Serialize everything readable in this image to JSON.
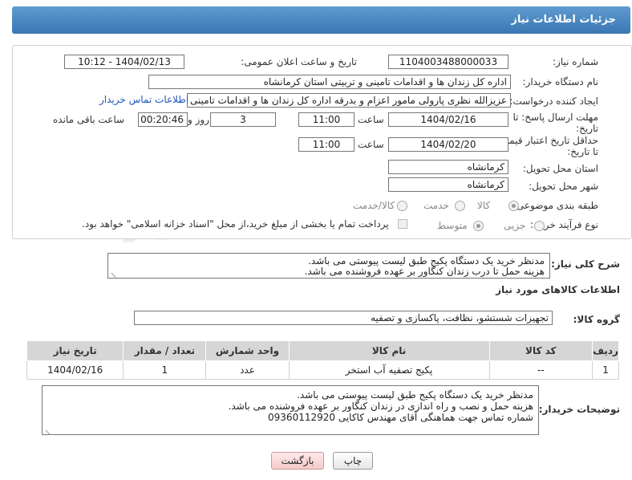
{
  "header": {
    "title": "جزئیات اطلاعات نیاز"
  },
  "form": {
    "need_number_label": "شماره نیاز:",
    "need_number": "1104003488000033",
    "announce_label": "تاریخ و ساعت اعلان عمومی:",
    "announce_value": "1404/02/13 - 10:12",
    "buyer_org_label": "نام دستگاه خریدار:",
    "buyer_org": "اداره کل زندان ها و اقدامات تامینی و تربیتی استان کرمانشاه",
    "creator_label": "ایجاد کننده درخواست:",
    "creator": "عزیزالله نظری پارولی مامور اعزام و بدرقه اداره کل زندان ها و اقدامات تامینی و تربیتی",
    "contact_link": "اطلاعات تماس خریدار",
    "deadline_label_line1": "مهلت ارسال پاسخ: تا",
    "deadline_label_line2": "تاریخ:",
    "deadline_date": "1404/02/16",
    "time_label": "ساعت",
    "deadline_time": "11:00",
    "days_value": "3",
    "days_label": "روز و",
    "remaining_time": "00:20:46",
    "remaining_label": "ساعت باقی مانده",
    "min_price_label_line1": "حداقل تاریخ اعتبار قیمت:",
    "min_price_label_line2": "تا تاریخ:",
    "min_price_date": "1404/02/20",
    "min_price_time": "11:00",
    "province_label": "استان محل تحویل:",
    "province": "کرمانشاه",
    "city_label": "شهر محل تحویل:",
    "city": "کرمانشاه",
    "category_label": "طبقه بندی موضوعی:",
    "category_options": [
      "کالا",
      "خدمت",
      "کالا/خدمت"
    ],
    "process_label": "نوع فرآیند خرید :",
    "process_options": [
      "جزیی",
      "متوسط"
    ],
    "payment_note": "پرداخت تمام یا بخشی از مبلغ خرید،از محل \"اسناد خزانه اسلامی\" خواهد بود."
  },
  "watermark": "AriaTender.net",
  "description": {
    "label": "شرح کلی نیاز:",
    "text": "مدنظر خرید یک دستگاه پکیج طبق لیست پیوستی می باشد.\nهزینه حمل تا درب زندان کنگاور بر عهده فروشنده می باشد."
  },
  "goods": {
    "section_title": "اطلاعات کالاهای مورد نیاز",
    "group_label": "گروه کالا:",
    "group_value": "تجهیزات شستشو، نظافت، پاکسازی و تصفیه",
    "columns": [
      "ردیف",
      "کد کالا",
      "نام کالا",
      "واحد شمارش",
      "تعداد / مقدار",
      "تاریخ نیاز"
    ],
    "rows": [
      {
        "index": "1",
        "code": "--",
        "name": "پکیج تصفیه آب استخر",
        "unit": "عدد",
        "qty": "1",
        "date": "1404/02/16"
      }
    ]
  },
  "buyer_notes": {
    "label": "توضیحات خریدار:",
    "text": "مدنظر خرید یک دستگاه پکیج طبق لیست پیوستی می باشد.\nهزینه حمل و نصب و راه اندازی در زندان کنگاور بر عهده فروشنده می باشد.\nشماره تماس جهت هماهنگی آقای مهندس کاکایی  09360112920"
  },
  "buttons": {
    "print": "چاپ",
    "back": "بازگشت"
  }
}
